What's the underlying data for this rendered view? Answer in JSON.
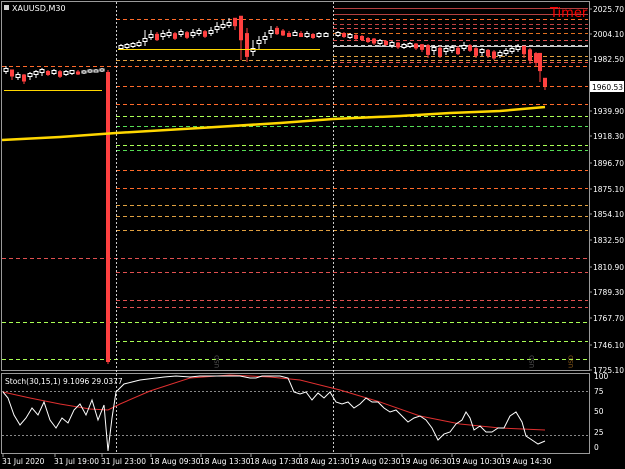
{
  "symbol_label": "XAUUSD,M30",
  "timer_label": "Timer",
  "current_price": "1960.53",
  "indicator_label": "Stoch(30,15,1) 9.1096 29.0377",
  "price_axis": [
    "2025.70",
    "2004.10",
    "1982.50",
    "1960.90",
    "1939.90",
    "1918.30",
    "1896.70",
    "1875.10",
    "1854.10",
    "1832.50",
    "1810.90",
    "1789.30",
    "1767.70",
    "1746.10",
    "1725.10"
  ],
  "indicator_axis": [
    "100",
    "75",
    "50",
    "25",
    "0"
  ],
  "time_axis": [
    "31 Jul 2020",
    "31 Jul 19:00",
    "31 Jul 23:00",
    "18 Aug 09:30",
    "18 Aug 13:30",
    "18 Aug 17:30",
    "18 Aug 21:30",
    "19 Aug 02:30",
    "19 Aug 06:30",
    "19 Aug 10:30",
    "19 Aug 14:30"
  ],
  "vertical_watermarks": [
    "USD",
    "USD",
    "USD"
  ],
  "colors": {
    "background": "#000000",
    "bull_candle": "#ffffff",
    "bear_candle": "#ff4040",
    "ma_line": "#ffd700",
    "stoch_main": "#ffffff",
    "stoch_signal": "#e03030",
    "timer": "#ff0000",
    "grid": "#ffffff"
  }
}
